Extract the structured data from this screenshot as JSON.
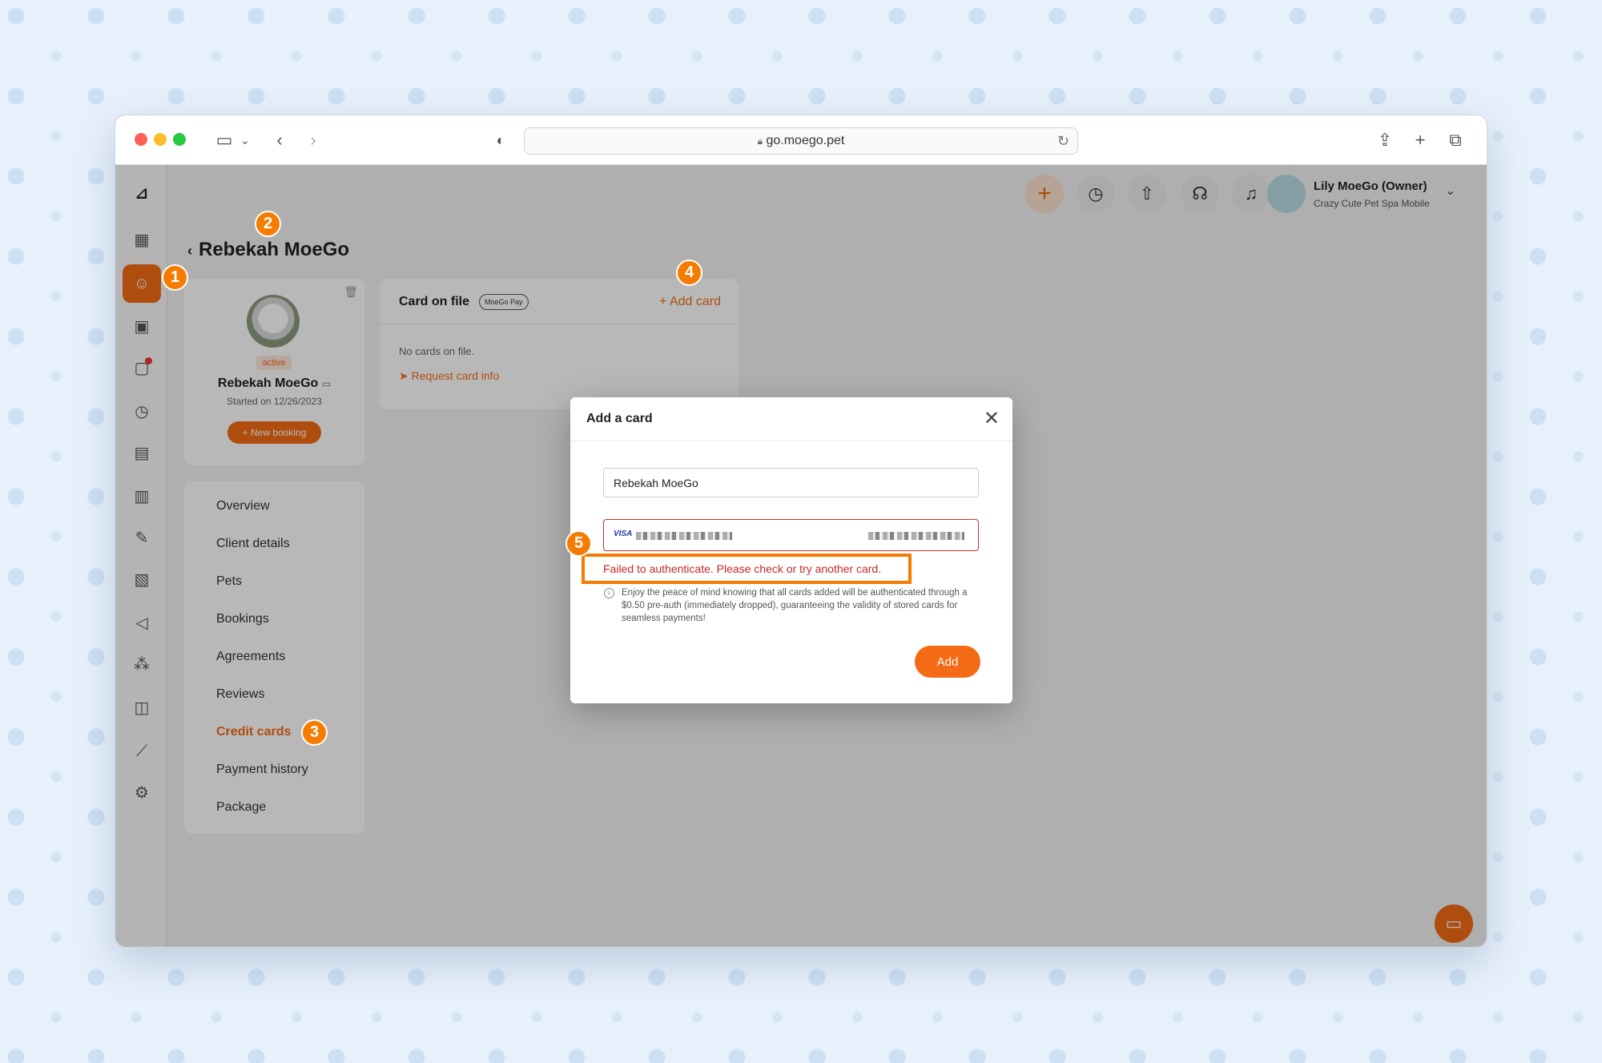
{
  "browser": {
    "url": "go.moego.pet"
  },
  "topbar": {
    "user_name": "Lily MoeGo (Owner)",
    "user_shop": "Crazy Cute Pet Spa Mobile"
  },
  "page": {
    "title": "Rebekah MoeGo"
  },
  "profile": {
    "status": "active",
    "name": "Rebekah MoeGo",
    "since": "Started on 12/26/2023",
    "new_booking": "+ New booking"
  },
  "menu": {
    "items": [
      "Overview",
      "Client details",
      "Pets",
      "Bookings",
      "Agreements",
      "Reviews",
      "Credit cards",
      "Payment history",
      "Package"
    ]
  },
  "card_on_file": {
    "title": "Card on file",
    "badge": "MoeGo Pay",
    "add_card": "+ Add card",
    "empty": "No cards on file.",
    "request": "Request card info"
  },
  "modal": {
    "title": "Add a card",
    "name_value": "Rebekah MoeGo",
    "card_brand": "VISA",
    "error": "Failed to authenticate. Please check or try another card.",
    "info": "Enjoy the peace of mind knowing that all cards added will be authenticated through a $0.50 pre-auth (immediately dropped), guaranteeing the validity of stored cards for seamless payments!",
    "add_button": "Add"
  },
  "steps": [
    "1",
    "2",
    "3",
    "4",
    "5"
  ],
  "colors": {
    "accent": "#f36b16",
    "error": "#d32f2f",
    "highlight": "#f57c00"
  },
  "icons": [
    "calendar-icon",
    "client-icon",
    "lock-icon",
    "message-icon",
    "alarm-icon",
    "card-icon",
    "clipboard-icon",
    "pen-icon",
    "ticket-icon",
    "megaphone-icon",
    "network-icon",
    "bag-icon",
    "chart-icon",
    "gear-icon"
  ]
}
